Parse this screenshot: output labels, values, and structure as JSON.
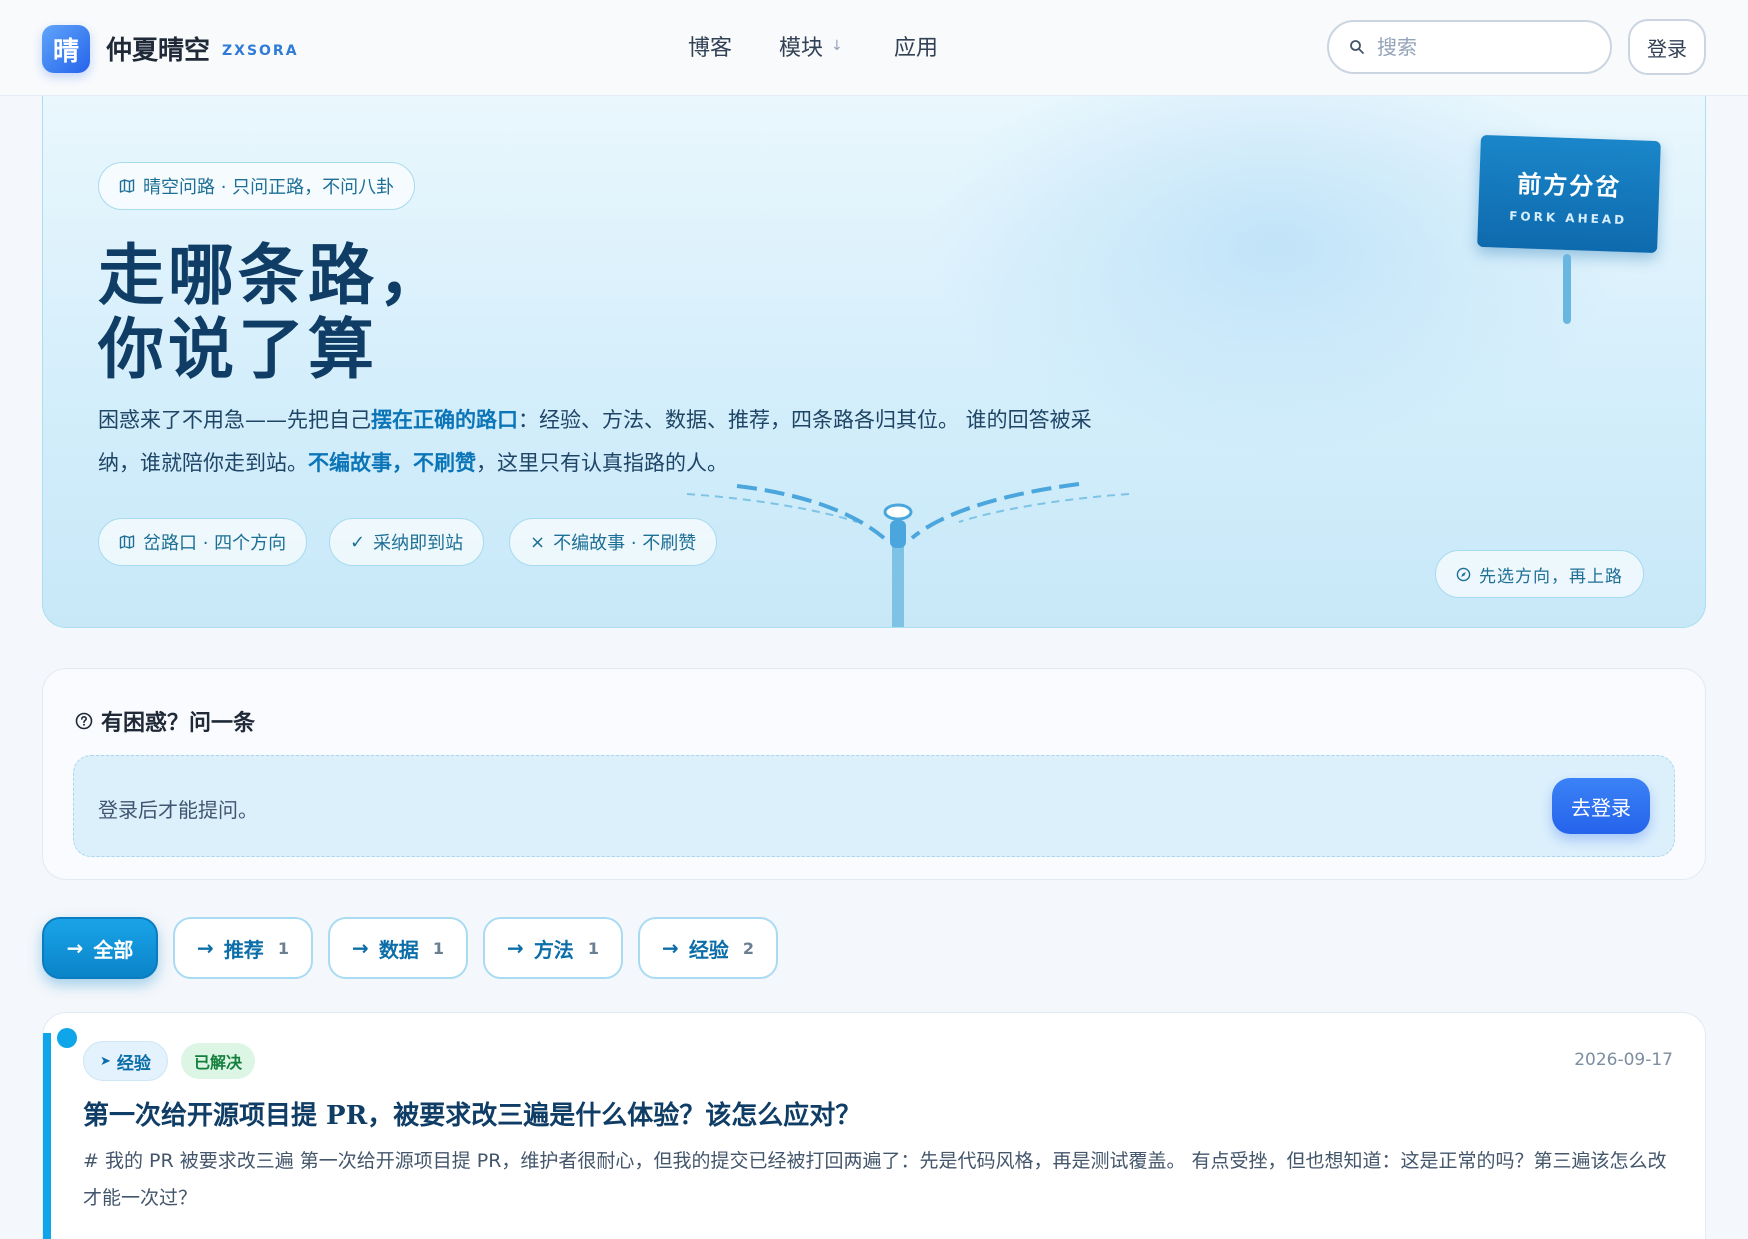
{
  "brand": {
    "logo_char": "晴",
    "name": "仲夏晴空",
    "sub": "ZXSORA"
  },
  "nav": {
    "items": [
      "博客",
      "模块",
      "应用"
    ]
  },
  "search": {
    "placeholder": "搜索"
  },
  "header": {
    "login_label": "登录"
  },
  "hero": {
    "tag": "晴空问路 · 只问正路，不问八卦",
    "title_line1": "走哪条路，",
    "title_line2": "你说了算",
    "desc_p1": "困惑来了不用急——先把自己",
    "desc_s1": "摆在正确的路口",
    "desc_p2": "：经验、方法、数据、推荐，四条路各归其位。 谁的回答被采纳，谁就陪你走到站。",
    "desc_s2": "不编故事，不刷赞",
    "desc_p3": "，这里只有认真指路的人。",
    "chips": [
      "岔路口 · 四个方向",
      "采纳即到站",
      "不编故事 · 不刷赞"
    ],
    "sign_title": "前方分岔",
    "sign_sub": "FORK AHEAD",
    "corner_tag": "先选方向，再上路"
  },
  "ask": {
    "title": "有困惑？问一条",
    "message": "登录后才能提问。",
    "button": "去登录"
  },
  "filters": [
    {
      "label": "全部",
      "count": null,
      "active": true
    },
    {
      "label": "推荐",
      "count": "1",
      "active": false
    },
    {
      "label": "数据",
      "count": "1",
      "active": false
    },
    {
      "label": "方法",
      "count": "1",
      "active": false
    },
    {
      "label": "经验",
      "count": "2",
      "active": false
    }
  ],
  "question": {
    "category": "经验",
    "status": "已解决",
    "date": "2026-09-17",
    "title": "第一次给开源项目提 PR，被要求改三遍是什么体验？该怎么应对？",
    "excerpt": "# 我的 PR 被要求改三遍 第一次给开源项目提 PR，维护者很耐心，但我的提交已经被打回两遍了：先是代码风格，再是测试覆盖。 有点受挫，但也想知道：这是正常的吗？第三遍该怎么改才能一次过？"
  },
  "colors": {
    "accent": "#0a84c9",
    "primary_button": "#2563eb",
    "title": "#0f3d66",
    "resolved": "#15803d"
  }
}
